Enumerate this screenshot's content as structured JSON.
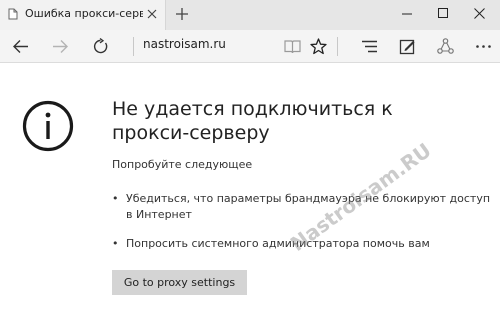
{
  "tab": {
    "title": "Ошибка прокси-сервер"
  },
  "address_bar": {
    "url": "nastroisam.ru"
  },
  "error": {
    "heading": "Не удается подключиться к прокси-серверу",
    "subtitle": "Попробуйте следующее",
    "suggestions": [
      "Убедиться, что параметры брандмауэра не блокируют доступ в Интернет",
      "Попросить системного администратора помочь вам"
    ],
    "button_label": "Go to proxy settings"
  },
  "watermark": "Nastroisam.RU",
  "colors": {
    "titlebar": "#e6e6e6",
    "tab_active": "#f2f2f2",
    "toolbar": "#f4f4f4",
    "button": "#d4d4d4",
    "text": "#222222"
  }
}
